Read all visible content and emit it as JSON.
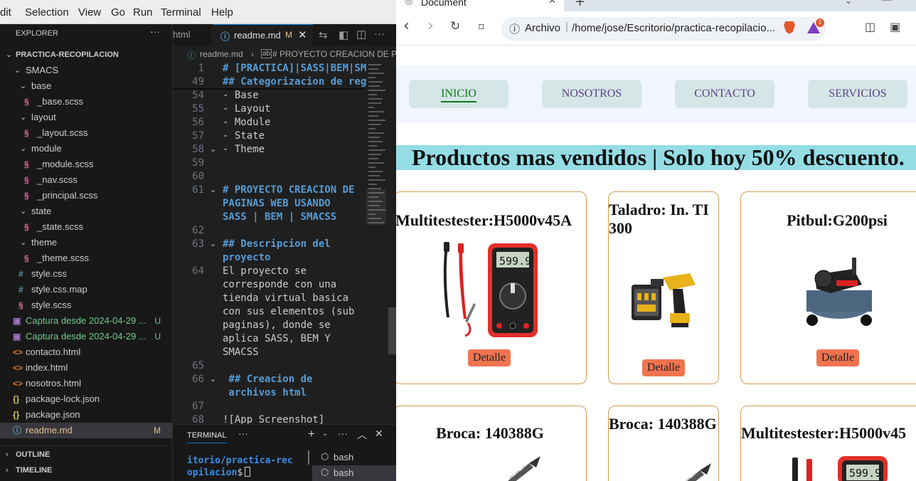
{
  "menu": [
    "dit",
    "Selection",
    "View",
    "Go",
    "Run",
    "Terminal",
    "Help"
  ],
  "explorer": {
    "title": "EXPLORER",
    "more": "···",
    "root": "PRACTICA-RECOPILACION",
    "items": [
      {
        "label": "SMACS",
        "type": "folder",
        "depth": 1
      },
      {
        "label": "base",
        "type": "folder",
        "depth": 2
      },
      {
        "label": "_base.scss",
        "type": "scss",
        "depth": 3
      },
      {
        "label": "layout",
        "type": "folder",
        "depth": 2
      },
      {
        "label": "_layout.scss",
        "type": "scss",
        "depth": 3
      },
      {
        "label": "module",
        "type": "folder",
        "depth": 2
      },
      {
        "label": "_module.scss",
        "type": "scss",
        "depth": 3
      },
      {
        "label": "_nav.scss",
        "type": "scss",
        "depth": 3
      },
      {
        "label": "_principal.scss",
        "type": "scss",
        "depth": 3
      },
      {
        "label": "state",
        "type": "folder",
        "depth": 2
      },
      {
        "label": "_state.scss",
        "type": "scss",
        "depth": 3
      },
      {
        "label": "theme",
        "type": "folder",
        "depth": 2
      },
      {
        "label": "_theme.scss",
        "type": "scss",
        "depth": 3
      },
      {
        "label": "style.css",
        "type": "css",
        "depth": 2
      },
      {
        "label": "style.css.map",
        "type": "css",
        "depth": 2
      },
      {
        "label": "style.scss",
        "type": "scss",
        "depth": 2
      },
      {
        "label": "Captura desde 2024-04-29 ...",
        "type": "img",
        "depth": 1,
        "status": "U"
      },
      {
        "label": "Captura desde 2024-04-29 ...",
        "type": "img",
        "depth": 1,
        "status": "U"
      },
      {
        "label": "contacto.html",
        "type": "html",
        "depth": 1
      },
      {
        "label": "index.html",
        "type": "html",
        "depth": 1
      },
      {
        "label": "nosotros.html",
        "type": "html",
        "depth": 1
      },
      {
        "label": "package-lock.json",
        "type": "json",
        "depth": 1
      },
      {
        "label": "package.json",
        "type": "json",
        "depth": 1
      },
      {
        "label": "readme.md",
        "type": "md",
        "depth": 1,
        "status": "M"
      }
    ],
    "outline": "OUTLINE",
    "timeline": "TIMELINE"
  },
  "editor": {
    "tab_prev": "html",
    "tab_active": "readme.md",
    "tab_active_status": "M",
    "breadcrumb_file": "readme.md",
    "breadcrumb_section": "# PROYECTO CREACION DE P",
    "lines": [
      {
        "n": "1",
        "text": "# [PRACTICA]|SASS|BEM|SM",
        "h": true
      },
      {
        "n": "49",
        "text": "## Categorizacion de reg",
        "h": true
      },
      {
        "n": "54",
        "text": "- Base",
        "h": false
      },
      {
        "n": "55",
        "text": "- Layout",
        "h": false
      },
      {
        "n": "56",
        "text": "- Module",
        "h": false
      },
      {
        "n": "57",
        "text": "- State",
        "h": false
      },
      {
        "n": "58",
        "text": "- Theme",
        "h": false
      },
      {
        "n": "59",
        "text": "",
        "h": false
      },
      {
        "n": "60",
        "text": "",
        "h": false
      },
      {
        "n": "61",
        "text": "# PROYECTO CREACION DE",
        "h": true
      },
      {
        "n": "",
        "text": "PAGINAS WEB USANDO",
        "h": true
      },
      {
        "n": "",
        "text": "SASS | BEM | SMACSS",
        "h": true
      },
      {
        "n": "62",
        "text": "",
        "h": false
      },
      {
        "n": "63",
        "text": "## Descripcion del",
        "h": true
      },
      {
        "n": "",
        "text": "proyecto",
        "h": true
      },
      {
        "n": "64",
        "text": "El proyecto se",
        "h": false
      },
      {
        "n": "",
        "text": "corresponde con una",
        "h": false
      },
      {
        "n": "",
        "text": "tienda virtual basica",
        "h": false
      },
      {
        "n": "",
        "text": "con sus elementos (sub",
        "h": false
      },
      {
        "n": "",
        "text": "paginas), donde se",
        "h": false
      },
      {
        "n": "",
        "text": "aplica SASS, BEM Y",
        "h": false
      },
      {
        "n": "",
        "text": "SMACSS",
        "h": false
      },
      {
        "n": "65",
        "text": "",
        "h": false
      },
      {
        "n": "66",
        "text": " ## Creacion de",
        "h": true
      },
      {
        "n": "",
        "text": " archivos html",
        "h": true
      },
      {
        "n": "67",
        "text": "",
        "h": false
      },
      {
        "n": "68",
        "text": "![App Screenshot]",
        "h": false
      }
    ]
  },
  "terminal": {
    "tab": "TERMINAL",
    "path_line1": "itorio/practica-rec",
    "path_line2": "opilacion",
    "prompt": "$",
    "shells": [
      "bash",
      "bash"
    ]
  },
  "browser": {
    "tab_title": "Document",
    "scheme_label": "Archivo",
    "url": "/home/jose/Escritorio/practica-recopilacio...",
    "badge": "1",
    "nav": [
      "INICIO",
      "NOSOTROS",
      "CONTACTO",
      "SERVICIOS"
    ],
    "banner": "Productos mas vendidos | Solo hoy 50% descuento.",
    "products": [
      {
        "title": "Multitestester:H5000v45A",
        "image": "multimeter",
        "button": "Detalle"
      },
      {
        "title": "Taladro: In. TI 300",
        "image": "drill",
        "button": "Detalle"
      },
      {
        "title": "Pitbul:G200psi",
        "image": "compressor",
        "button": "Detalle"
      },
      {
        "title": "Broca: 140388G",
        "image": "drill-bit",
        "button": ""
      },
      {
        "title": "Broca: 140388G",
        "image": "drill-bit",
        "button": ""
      },
      {
        "title": "Multitestester:H5000v45",
        "image": "multimeter",
        "button": ""
      }
    ],
    "multimeter_reading": "599.9"
  },
  "colors": {
    "accent": "#569cd6",
    "untracked": "#73c991",
    "modified": "#e2c08d",
    "nav_btn": "#d5e6e6",
    "banner": "#94dde5",
    "detail_btn": "#f0734f",
    "card_border": "#d79a55"
  }
}
